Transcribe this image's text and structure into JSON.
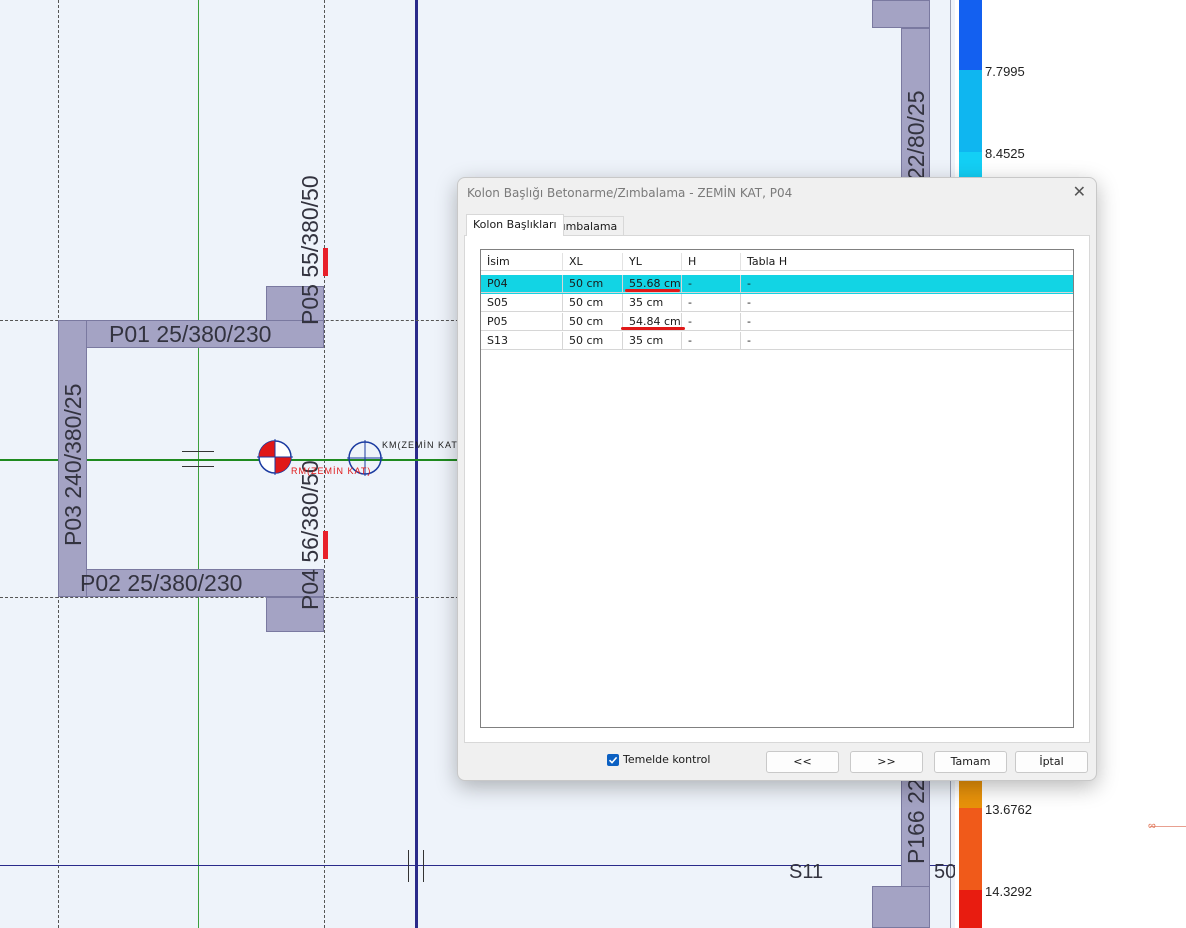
{
  "cad": {
    "beams": {
      "p01": "P01 25/380/230",
      "p02": "P02 25/380/230",
      "p03": "P03 240/380/25",
      "p05": "P05 55/380/50",
      "p04": "P04 56/380/50",
      "p22": "22/80/25",
      "p166": "P166 22",
      "s11": "S11",
      "s11_partial": "50"
    },
    "km_label": "KM(ZEMİN KAT",
    "rm_label": "RM(ZEMİN KAT)"
  },
  "legend": {
    "values": [
      "7.7995",
      "8.4525",
      "13.6762",
      "14.3292"
    ],
    "colors": [
      "#1360f0",
      "#0fb6f0",
      "#13cff5",
      "#e8920a",
      "#f05a1a",
      "#e81c10"
    ]
  },
  "dialog": {
    "title": "Kolon Başlığı Betonarme/Zımbalama - ZEMİN KAT, P04",
    "close": "✕",
    "tabs": [
      "Kolon Başlıkları",
      "Zımbalama"
    ],
    "columns": [
      "İsim",
      "XL",
      "YL",
      "H",
      "Tabla H"
    ],
    "rows": [
      {
        "name": "P04",
        "xl": "50 cm",
        "yl": "55.68 cm",
        "h": "-",
        "tabla_h": "-"
      },
      {
        "name": "S05",
        "xl": "50 cm",
        "yl": "35 cm",
        "h": "-",
        "tabla_h": "-"
      },
      {
        "name": "P05",
        "xl": "50 cm",
        "yl": "54.84 cm",
        "h": "-",
        "tabla_h": "-"
      },
      {
        "name": "S13",
        "xl": "50 cm",
        "yl": "35 cm",
        "h": "-",
        "tabla_h": "-"
      }
    ],
    "checkbox_label": "Temelde kontrol",
    "checkbox_checked": true,
    "buttons": {
      "prev": "<<",
      "next": ">>",
      "ok": "Tamam",
      "cancel": "İptal"
    }
  }
}
